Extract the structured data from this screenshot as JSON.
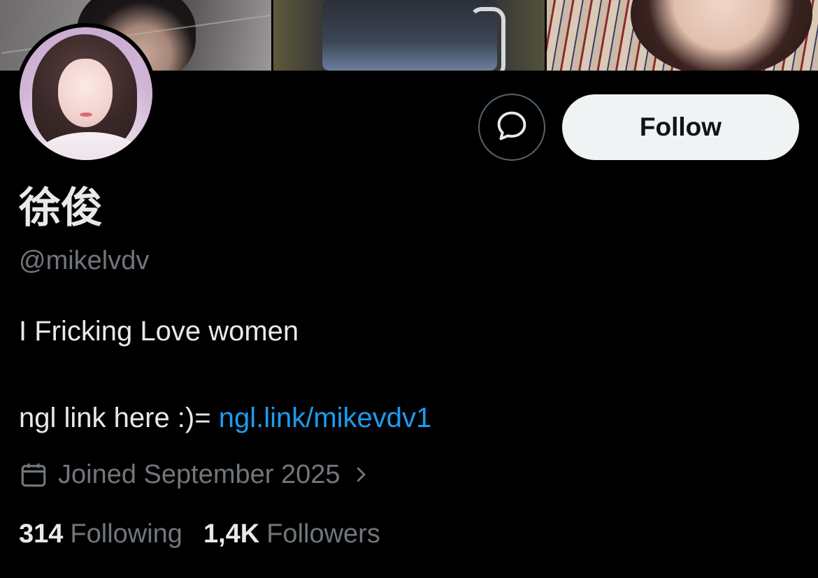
{
  "profile": {
    "display_name": "徐俊",
    "handle": "@mikelvdv",
    "bio_line1": "I Fricking Love women",
    "bio_line2_prefix": "ngl link here :)= ",
    "bio_link": "ngl.link/mikevdv1",
    "joined": "Joined September 2025"
  },
  "actions": {
    "follow_label": "Follow"
  },
  "stats": {
    "following_count": "314",
    "following_label": "Following",
    "followers_count": "1,4K",
    "followers_label": "Followers"
  },
  "icons": {
    "message": "message-bubble-icon",
    "calendar": "calendar-icon",
    "chevron": "chevron-right-icon"
  },
  "colors": {
    "background": "#000000",
    "primary_text": "#e7e9ea",
    "secondary_text": "#71767b",
    "link": "#1d9bf0",
    "follow_button_bg": "#eff3f4",
    "follow_button_text": "#0f1419"
  }
}
